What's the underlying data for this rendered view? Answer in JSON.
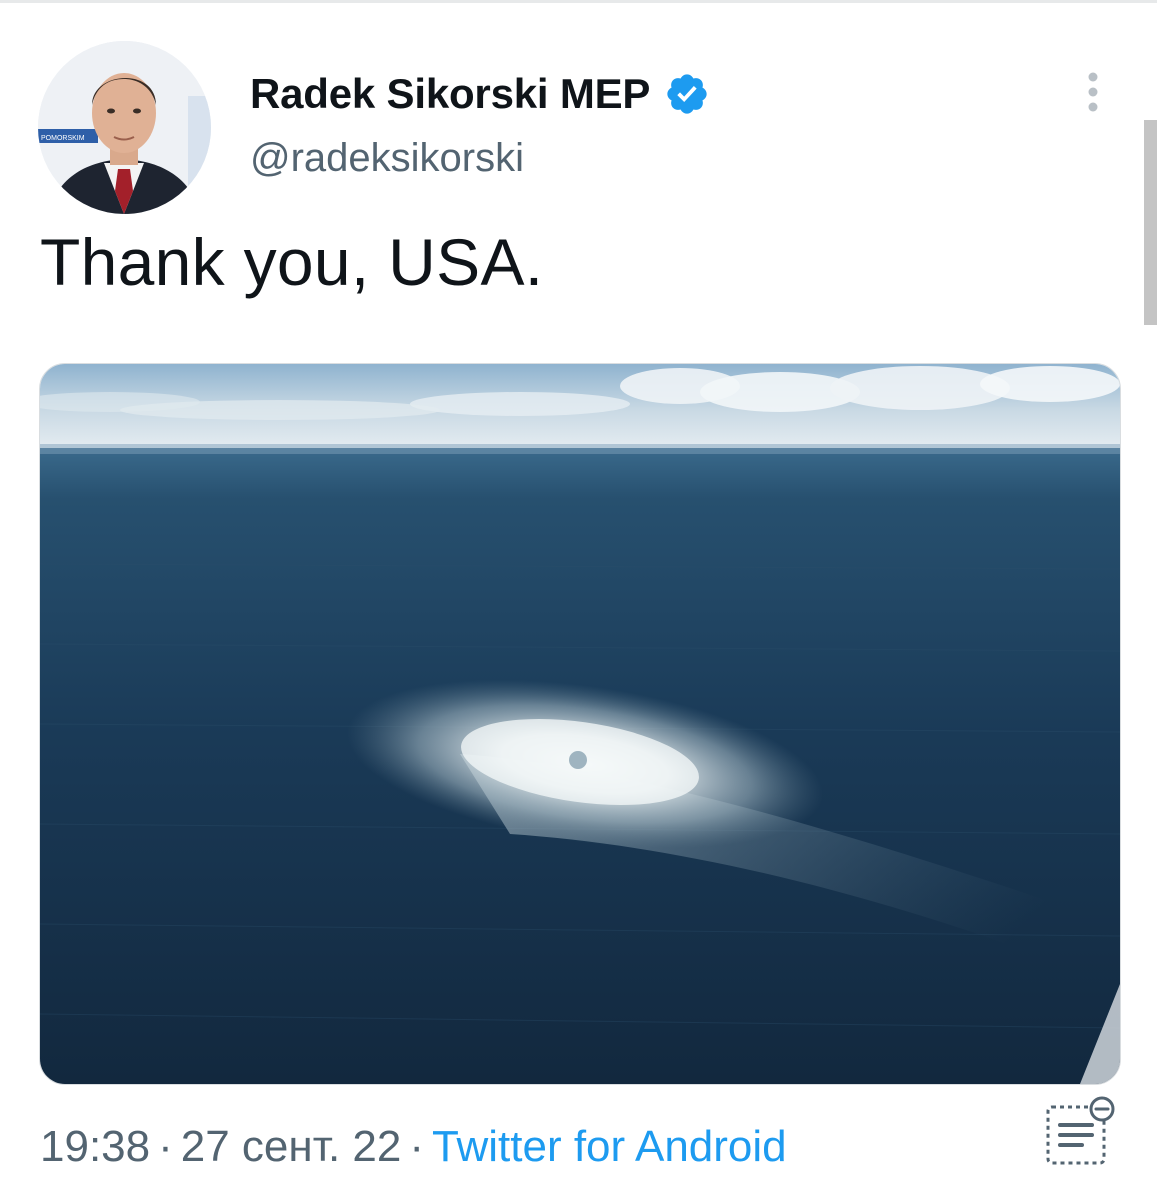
{
  "tweet": {
    "display_name": "Radek Sikorski MEP",
    "handle": "@radeksikorski",
    "text": "Thank you, USA.",
    "time": "19:38",
    "separator": "·",
    "date": "27 сент. 22",
    "source": "Twitter for Android",
    "verified": true
  },
  "avatar": {
    "backdrop_text": "POMORSKIM"
  },
  "icons": {
    "verified": "verified-badge-icon",
    "more": "vertical-ellipsis-icon",
    "analytics": "tweet-analytics-icon"
  },
  "colors": {
    "name": "#0f1419",
    "secondary": "#536471",
    "link": "#1d9bf0",
    "verified": "#1d9bf0",
    "divider": "#e7e9ea"
  }
}
